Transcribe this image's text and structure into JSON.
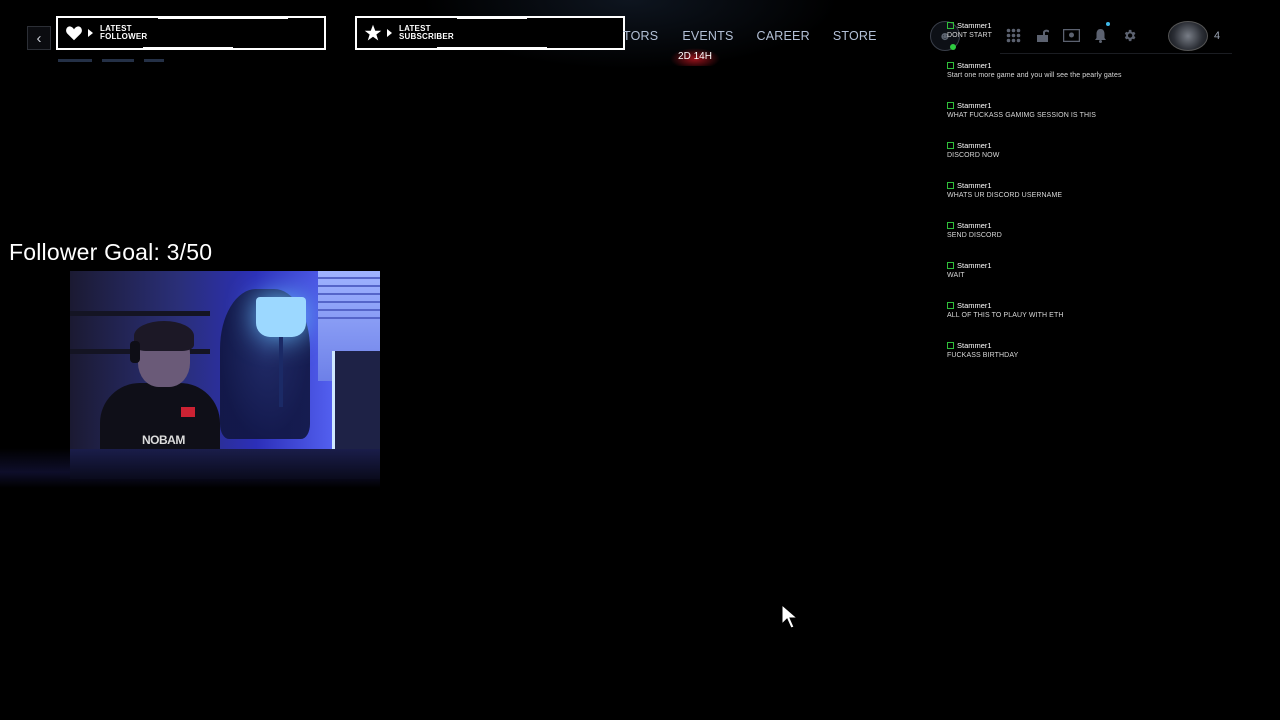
{
  "alerts": {
    "follower": {
      "line1": "LATEST",
      "line2": "FOLLOWER",
      "icon": "heart-icon"
    },
    "subscriber": {
      "line1": "LATEST",
      "line2": "SUBSCRIBER",
      "icon": "star-icon"
    }
  },
  "nav": {
    "items": [
      {
        "label": "TORS"
      },
      {
        "label": "EVENTS"
      },
      {
        "label": "CAREER"
      },
      {
        "label": "STORE"
      }
    ],
    "event_timer": "2D 14H"
  },
  "header": {
    "back_icon": "chevron-left-icon",
    "currency_count": "4",
    "icons": [
      "grid-icon",
      "unlock-icon",
      "id-card-icon",
      "bell-icon",
      "gear-icon"
    ]
  },
  "chat": {
    "messages": [
      {
        "user": "Stammer1",
        "text": "DONT START"
      },
      {
        "user": "Stammer1",
        "text": "Start one more game and you will see the pearly gates"
      },
      {
        "user": "Stammer1",
        "text": "WHAT FUCKASS GAMIMG SESSION IS THIS"
      },
      {
        "user": "Stammer1",
        "text": "DISCORD NOW"
      },
      {
        "user": "Stammer1",
        "text": "WHATS UR DISCORD USERNAME"
      },
      {
        "user": "Stammer1",
        "text": "SEND DISCORD"
      },
      {
        "user": "Stammer1",
        "text": "WAIT"
      },
      {
        "user": "Stammer1",
        "text": "ALL OF THIS TO PLAUY WITH ETH"
      },
      {
        "user": "Stammer1",
        "text": "FUCKASS BIRTHDAY"
      }
    ]
  },
  "follower_goal": {
    "label": "Follower Goal: 3/50"
  },
  "webcam": {
    "shirt_text": "NOBAM"
  },
  "colors": {
    "chat_badge": "#2fbf3a",
    "nav_text": "#b3c0d6",
    "timer_glow": "#aa141e"
  }
}
